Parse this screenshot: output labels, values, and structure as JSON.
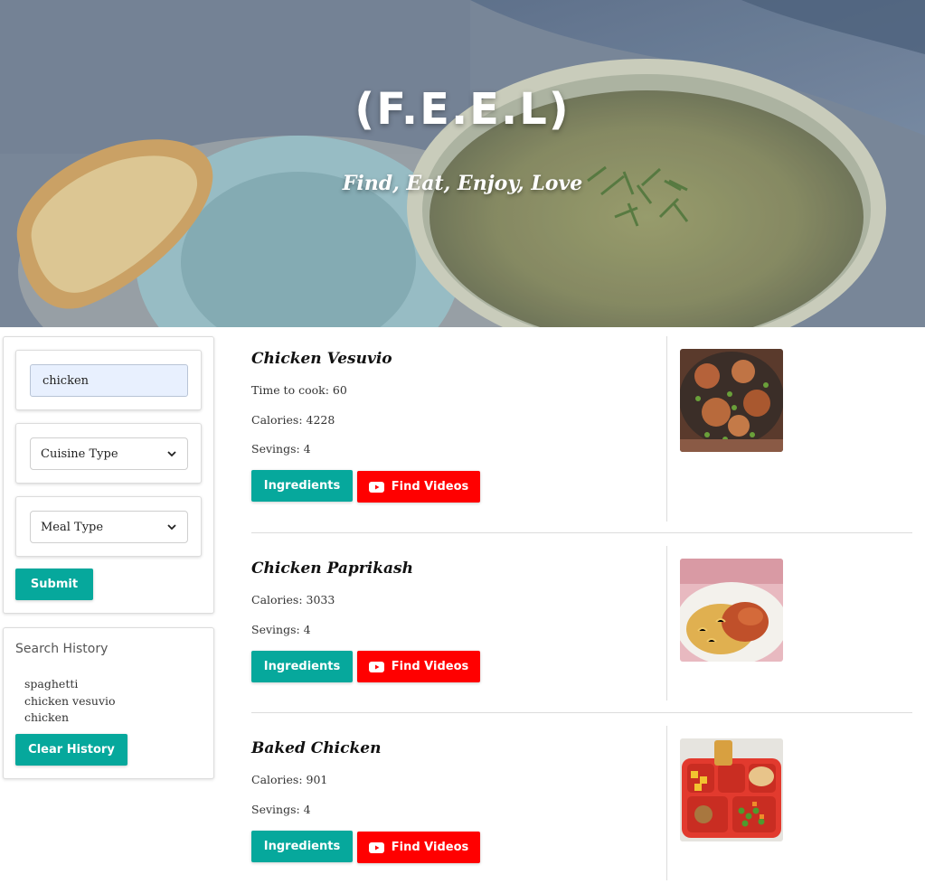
{
  "hero": {
    "title": "(F.E.E.L)",
    "subtitle": "Find, Eat, Enjoy, Love"
  },
  "search_form": {
    "search_value": "chicken",
    "cuisine_selected": "Cuisine Type",
    "meal_selected": "Meal Type",
    "submit_label": "Submit"
  },
  "history": {
    "title": "Search History",
    "items": [
      "spaghetti",
      "chicken vesuvio",
      "chicken"
    ],
    "clear_label": "Clear History"
  },
  "recipes": [
    {
      "name": "Chicken Vesuvio",
      "time": "Time to cook: 60",
      "calories": "Calories: 4228",
      "servings": "Sevings: 4",
      "ingredients_label": "Ingredients",
      "videos_label": "Find Videos",
      "image_icon": "chicken-vesuvio-photo"
    },
    {
      "name": "Chicken Paprikash",
      "calories": "Calories: 3033",
      "servings": "Sevings: 4",
      "ingredients_label": "Ingredients",
      "videos_label": "Find Videos",
      "image_icon": "chicken-paprikash-photo"
    },
    {
      "name": "Baked Chicken",
      "calories": "Calories: 901",
      "servings": "Sevings: 4",
      "ingredients_label": "Ingredients",
      "videos_label": "Find Videos",
      "image_icon": "baked-chicken-photo"
    }
  ],
  "colors": {
    "accent_teal": "#06a89c",
    "video_red": "#ff0000"
  }
}
